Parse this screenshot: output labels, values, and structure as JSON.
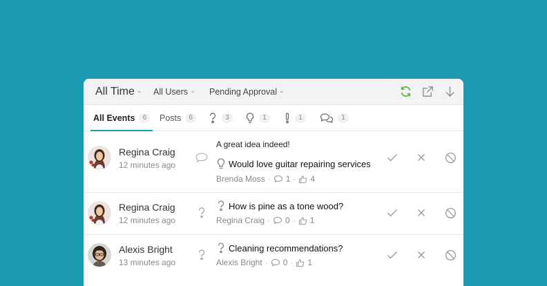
{
  "colors": {
    "accent": "#1a9bb2",
    "refresh": "#5bb53c",
    "muted_icon": "#9a9a9a"
  },
  "topbar": {
    "time_filter": "All Time",
    "users_filter": "All Users",
    "status_filter": "Pending Approval",
    "icons": [
      "refresh-icon",
      "external-link-icon",
      "arrow-down-icon"
    ]
  },
  "tabs": [
    {
      "label": "All Events",
      "count": "6",
      "icon": ""
    },
    {
      "label": "Posts",
      "count": "6",
      "icon": ""
    },
    {
      "label": "",
      "count": "3",
      "icon": "question-icon"
    },
    {
      "label": "",
      "count": "1",
      "icon": "idea-icon"
    },
    {
      "label": "",
      "count": "1",
      "icon": "exclamation-icon"
    },
    {
      "label": "",
      "count": "1",
      "icon": "comments-icon"
    }
  ],
  "events": [
    {
      "user": "Regina Craig",
      "time": "12 minutes ago",
      "type_icon": "comment-icon",
      "comment": "A great idea indeed!",
      "post_icon": "idea-icon",
      "post_title": "Would love guitar repairing services",
      "author": "Brenda Moss",
      "comments": "1",
      "likes": "4"
    },
    {
      "user": "Regina Craig",
      "time": "12 minutes ago",
      "type_icon": "question-icon",
      "comment": "",
      "post_icon": "question-icon",
      "post_title": "How is pine as a tone wood?",
      "author": "Regina Craig",
      "comments": "0",
      "likes": "1"
    },
    {
      "user": "Alexis Bright",
      "time": "13 minutes ago",
      "type_icon": "question-icon",
      "comment": "",
      "post_icon": "question-icon",
      "post_title": "Cleaning recommendations?",
      "author": "Alexis Bright",
      "comments": "0",
      "likes": "1"
    }
  ],
  "meta_separator": "·"
}
